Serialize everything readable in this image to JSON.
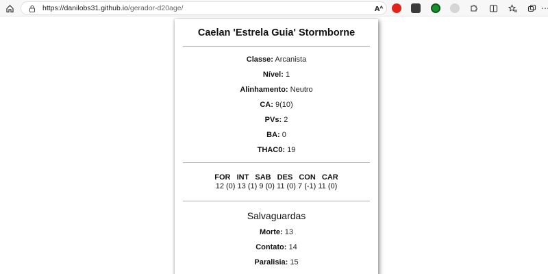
{
  "browser": {
    "url_host": "https://danilobs31.github.io",
    "url_path": "/gerador-d20age/",
    "read_aloud_label": "Aᴬ"
  },
  "sheet": {
    "name": "Caelan 'Estrela Guia' Stormborne",
    "stats": [
      {
        "label": "Classe:",
        "value": "Arcanista"
      },
      {
        "label": "Nível:",
        "value": "1"
      },
      {
        "label": "Alinhamento:",
        "value": "Neutro"
      },
      {
        "label": "CA:",
        "value": "9(10)"
      },
      {
        "label": "PVs:",
        "value": "2"
      },
      {
        "label": "BA:",
        "value": "0"
      },
      {
        "label": "THAC0:",
        "value": "19"
      }
    ],
    "attributes": {
      "headers": [
        "FOR",
        "INT",
        "SAB",
        "DES",
        "CON",
        "CAR"
      ],
      "values": [
        "12 (0)",
        "13 (1)",
        "9 (0)",
        "11 (0)",
        "7 (-1)",
        "11 (0)"
      ]
    },
    "saves_title": "Salvaguardas",
    "saves": [
      {
        "label": "Morte:",
        "value": "13"
      },
      {
        "label": "Contato:",
        "value": "14"
      },
      {
        "label": "Paralisia:",
        "value": "15"
      }
    ]
  }
}
